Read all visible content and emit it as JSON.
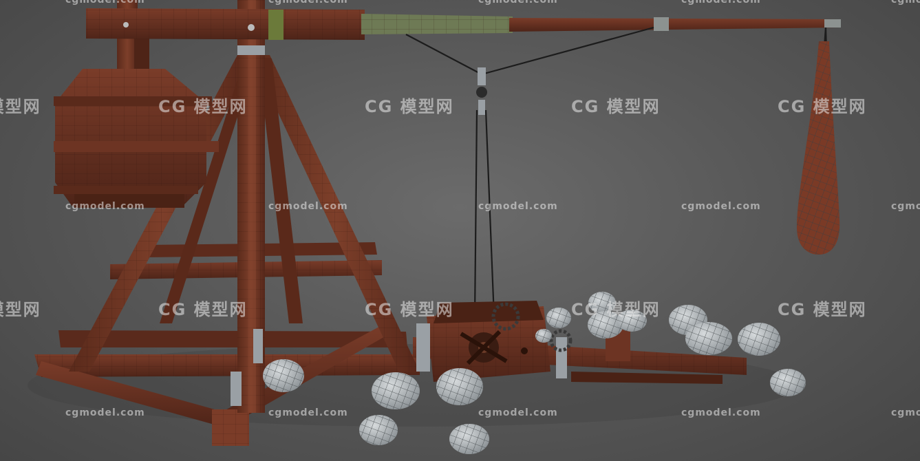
{
  "watermark": {
    "url_text": "cgmodel.com",
    "brand_text": "CG 模型网"
  },
  "colors": {
    "background": "#595959",
    "wood": "#6e3524",
    "wood_dark": "#4a2316",
    "rope": "#1c1c1c",
    "stone": "#b7bcbf",
    "metal": "#9aa0a5"
  },
  "subject": {
    "object": "trebuchet-model",
    "stone_count": 14
  }
}
